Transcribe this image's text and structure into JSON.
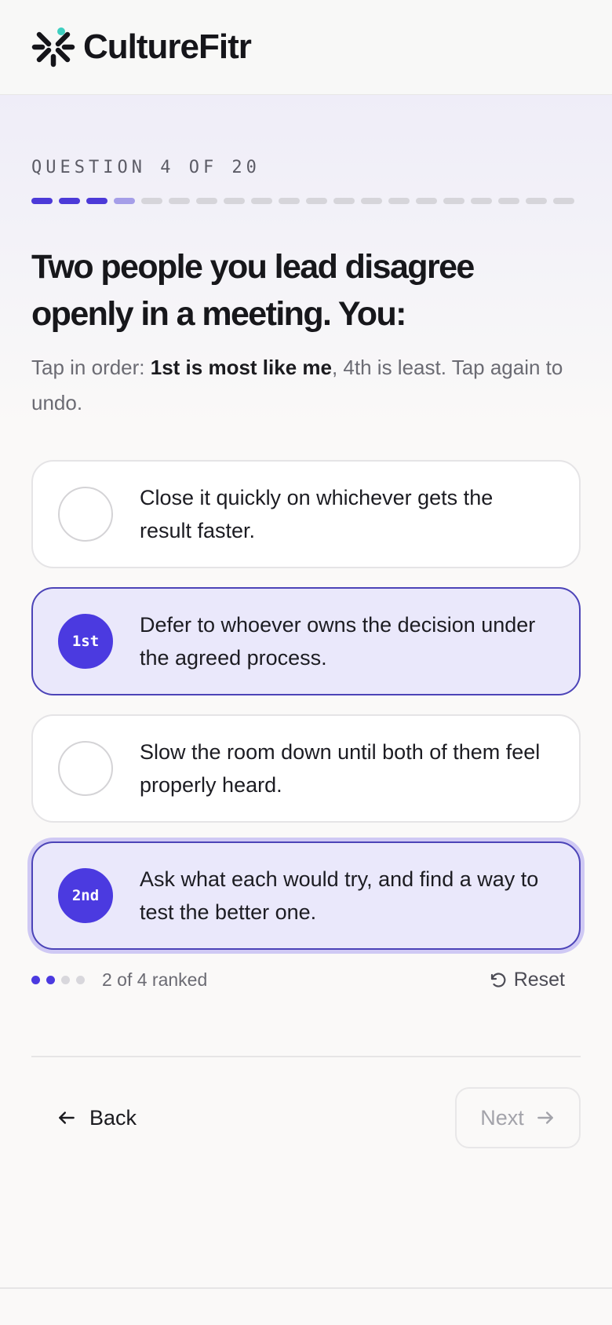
{
  "brand": {
    "name": "CultureFitr",
    "accent": "#4b3ae0",
    "dot_color": "#3ecfc0"
  },
  "progress": {
    "label": "QUESTION 4 OF 20",
    "current": 4,
    "total": 20
  },
  "question": {
    "text": "Two people you lead disagree openly in a meeting. You:",
    "instruction_pre": "Tap in order: ",
    "instruction_bold": "1st is most like me",
    "instruction_post": ", 4th is least. Tap again to undo."
  },
  "options": [
    {
      "text": "Close it quickly on whichever gets the result faster.",
      "rank": ""
    },
    {
      "text": "Defer to whoever owns the decision under the agreed process.",
      "rank": "1st"
    },
    {
      "text": "Slow the room down until both of them feel properly heard.",
      "rank": ""
    },
    {
      "text": "Ask what each would try, and find a way to test the better one.",
      "rank": "2nd"
    }
  ],
  "ranking_status": {
    "text": "2 of 4 ranked",
    "ranked": 2,
    "total": 4
  },
  "reset_label": "Reset",
  "nav": {
    "back_label": "Back",
    "next_label": "Next"
  },
  "icons": {
    "logo": "asterisk-people-logo-icon",
    "reset": "undo-arrow-icon",
    "back": "arrow-left-icon",
    "next": "arrow-right-icon"
  }
}
